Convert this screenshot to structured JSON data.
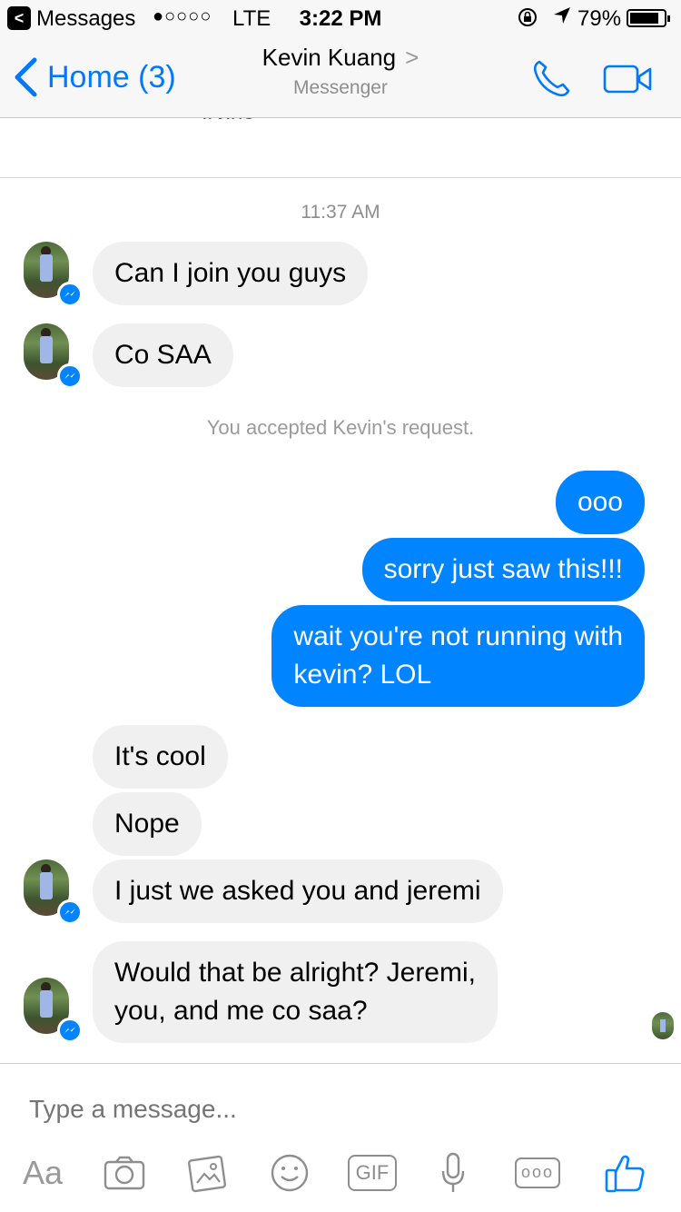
{
  "status_bar": {
    "app_back": "<",
    "app_name": "Messages",
    "signal": "●○○○○",
    "carrier": "LTE",
    "time": "3:22 PM",
    "lock_icon": "↻",
    "location_icon": "↗",
    "battery": "79%"
  },
  "nav": {
    "back_label": "Home (3)",
    "title": "Kevin Kuang",
    "title_chevron": ">",
    "subtitle": "Messenger"
  },
  "chat": {
    "previous_card_text": "Irvine",
    "timestamp": "11:37 AM",
    "notice": "You accepted Kevin's request.",
    "messages": [
      {
        "side": "in",
        "text": "Can I join you guys"
      },
      {
        "side": "in",
        "text": "Co SAA"
      },
      {
        "side": "out",
        "text": "ooo"
      },
      {
        "side": "out",
        "text": "sorry just saw this!!!"
      },
      {
        "side": "out",
        "text": "wait you're not running with\nkevin? LOL"
      },
      {
        "side": "in",
        "text": "It's cool"
      },
      {
        "side": "in",
        "text": "Nope"
      },
      {
        "side": "in",
        "text": "I just we asked you and jeremi"
      },
      {
        "side": "in",
        "text": "Would that be alright? Jeremi,\nyou, and me co saa?"
      }
    ]
  },
  "composer": {
    "placeholder": "Type a message...",
    "tools": {
      "text": "Aa",
      "gif": "GIF",
      "more": "ooo"
    }
  },
  "colors": {
    "accent": "#0084ff",
    "nav_blue": "#0079ff",
    "incoming_bubble": "#f1f0f0",
    "background": "#ffffff"
  }
}
